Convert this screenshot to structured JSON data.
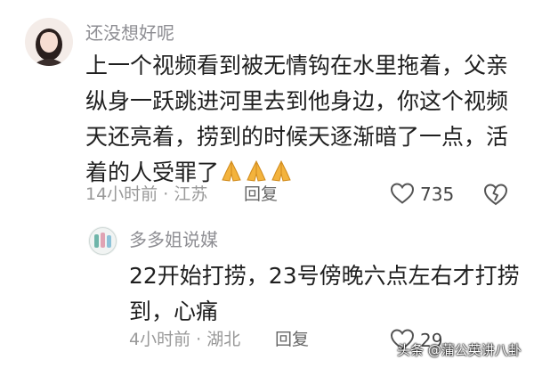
{
  "comment": {
    "username": "还没想好呢",
    "lines": [
      "上一个视频看到被无情钩在水里拖着，父亲",
      "纵身一跃跳进河里去到他身边，你这个视频",
      "天还亮着，捞到的时候天逐渐暗了一点，活",
      "着的人受罪了"
    ],
    "emoji_icons": [
      "praying-hands",
      "praying-hands",
      "praying-hands"
    ],
    "time": "14小时前",
    "location": "江苏",
    "reply_label": "回复",
    "likes": "735"
  },
  "reply": {
    "username": "多多姐说媒",
    "lines": [
      "22开始打捞，23号傍晚六点左右才打捞",
      "到，心痛"
    ],
    "time": "4小时前",
    "location": "湖北",
    "reply_label": "回复",
    "likes": "29"
  },
  "watermark": "头条 @蒲公英讲八卦",
  "colors": {
    "body_text": "#1f1f1f",
    "muted_text": "#999999",
    "username": "#8e8e93",
    "icon_stroke": "#666666"
  }
}
